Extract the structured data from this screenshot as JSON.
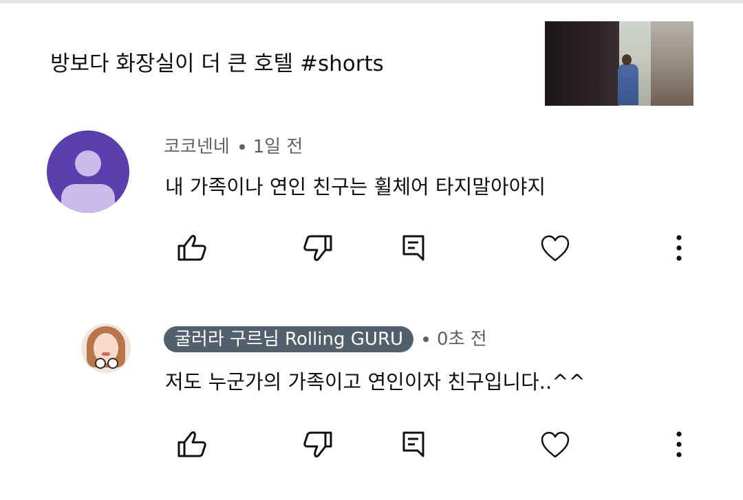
{
  "video": {
    "title": "방보다 화장실이 더 큰 호텔 #shorts"
  },
  "comments": [
    {
      "author": "코코넨네",
      "time": "1일 전",
      "text": "내 가족이나 연인 친구는 휠체어 타지말아야지",
      "avatar": "default-avatar-icon",
      "avatar_color": "#5b3fad"
    },
    {
      "author": "굴러라 구르님 Rolling GURU",
      "time": "0초 전",
      "text": "저도 누군가의 가족이고 연인이자 친구입니다..^^",
      "avatar": "profile-photo",
      "creator_badge_color": "#52606e"
    }
  ],
  "actions": {
    "icons": [
      "thumbs-up-icon",
      "thumbs-down-icon",
      "reply-icon",
      "heart-icon",
      "more-vert-icon"
    ]
  }
}
